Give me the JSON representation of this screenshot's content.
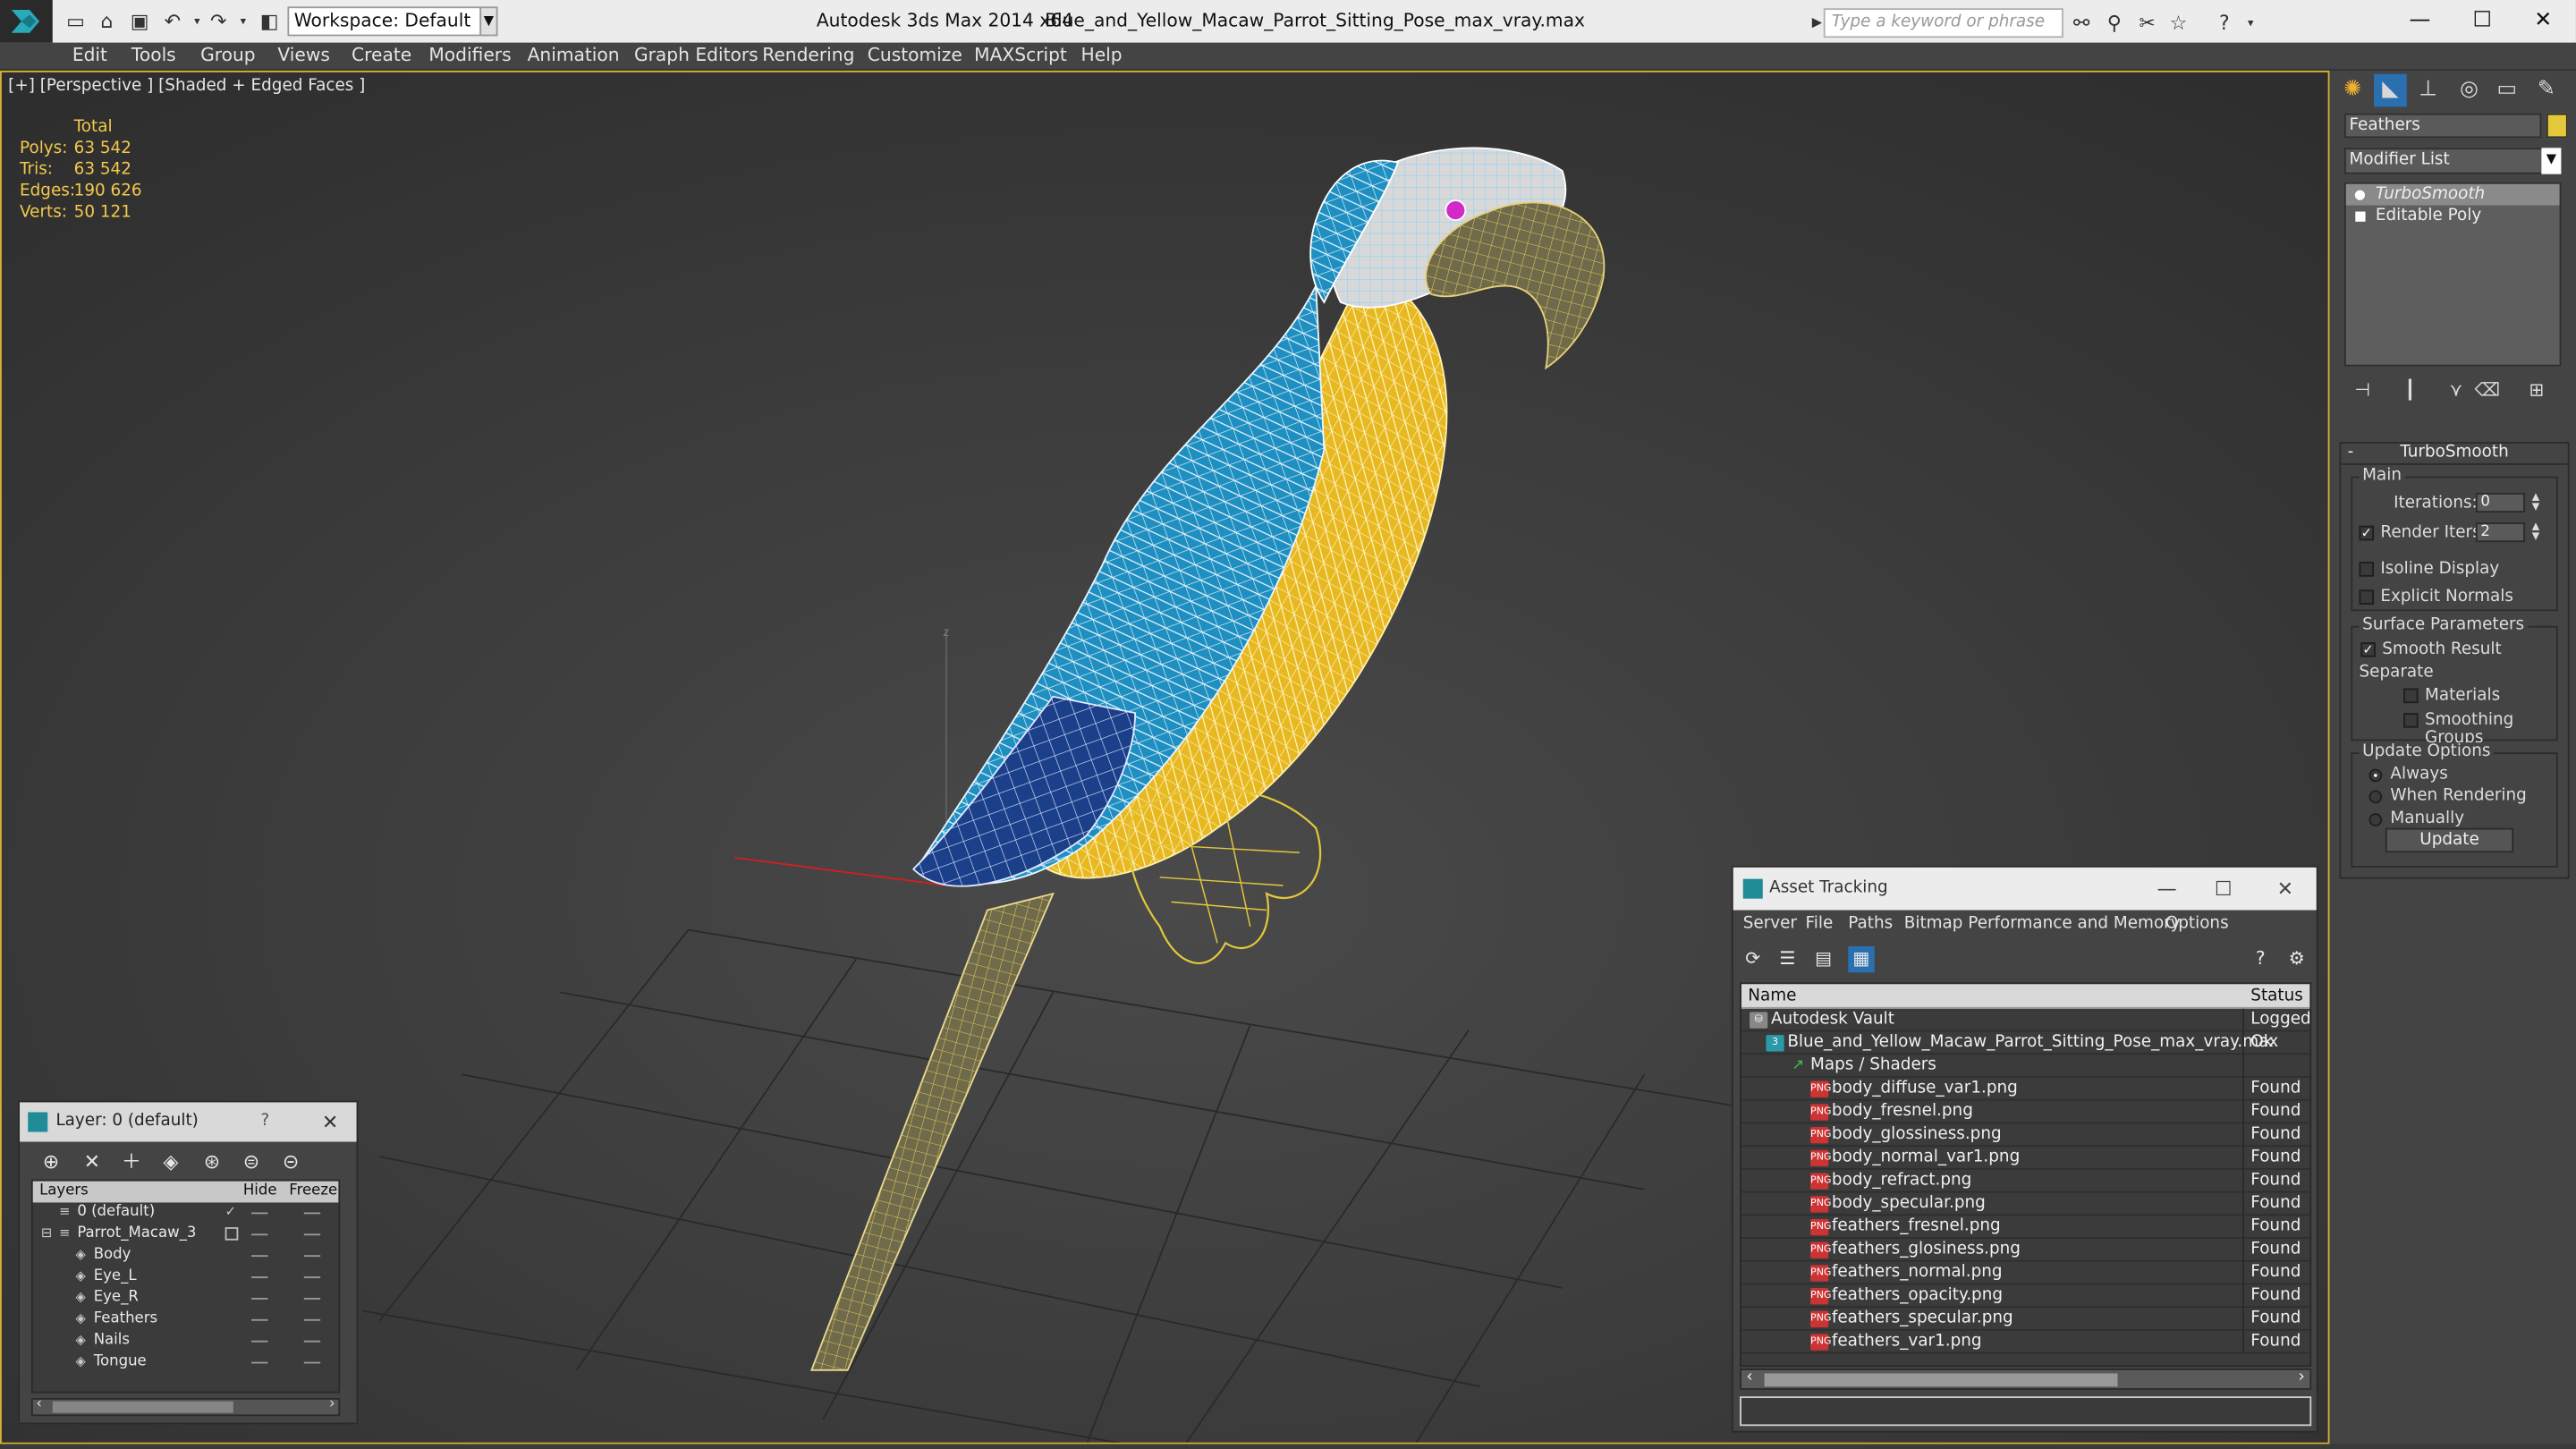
{
  "titlebar": {
    "workspace": "Workspace: Default",
    "app": "Autodesk 3ds Max  2014 x64",
    "file": "Blue_and_Yellow_Macaw_Parrot_Sitting_Pose_max_vray.max",
    "search_placeholder": "Type a keyword or phrase"
  },
  "menu": [
    "Edit",
    "Tools",
    "Group",
    "Views",
    "Create",
    "Modifiers",
    "Animation",
    "Graph Editors",
    "Rendering",
    "Customize",
    "MAXScript",
    "Help"
  ],
  "viewport": {
    "label": "[+] [Perspective ] [Shaded + Edged Faces ]",
    "stats": {
      "header": "Total",
      "rows": [
        {
          "k": "Polys:",
          "v": "63 542"
        },
        {
          "k": "Tris:",
          "v": "63 542"
        },
        {
          "k": "Edges:",
          "v": "190 626"
        },
        {
          "k": "Verts:",
          "v": "50 121"
        }
      ]
    },
    "axis_label": "z"
  },
  "command_panel": {
    "object_name": "Feathers",
    "object_color": "#e3c83b",
    "modifier_list": "Modifier List",
    "stack": [
      "TurboSmooth",
      "Editable Poly"
    ],
    "rollout_title": "TurboSmooth",
    "main_group": "Main",
    "iterations_label": "Iterations:",
    "iterations_value": "0",
    "render_iters_label": "Render Iters:",
    "render_iters_value": "2",
    "isoline_label": "Isoline Display",
    "explicit_label": "Explicit Normals",
    "surface_group": "Surface Parameters",
    "smooth_result_label": "Smooth Result",
    "separate_label": "Separate",
    "materials_label": "Materials",
    "smoothing_groups_label": "Smoothing Groups",
    "update_group": "Update Options",
    "always_label": "Always",
    "when_rendering_label": "When Rendering",
    "manually_label": "Manually",
    "update_button": "Update"
  },
  "layer_window": {
    "title": "Layer: 0 (default)",
    "help": "?",
    "columns": [
      "Layers",
      "Hide",
      "Freeze"
    ],
    "rows": [
      {
        "name": "0 (default)",
        "indent": 0
      },
      {
        "name": "Parrot_Macaw_3",
        "indent": 0
      },
      {
        "name": "Body",
        "indent": 1
      },
      {
        "name": "Eye_L",
        "indent": 1
      },
      {
        "name": "Eye_R",
        "indent": 1
      },
      {
        "name": "Feathers",
        "indent": 1
      },
      {
        "name": "Nails",
        "indent": 1
      },
      {
        "name": "Tongue",
        "indent": 1
      }
    ]
  },
  "asset_tracking": {
    "title": "Asset Tracking",
    "menu": [
      "Server",
      "File",
      "Paths",
      "Bitmap Performance and Memory",
      "Options"
    ],
    "columns": [
      "Name",
      "Status"
    ],
    "rows": [
      {
        "name": "Autodesk Vault",
        "status": "Logged",
        "indent": 0,
        "kind": "vault"
      },
      {
        "name": "Blue_and_Yellow_Macaw_Parrot_Sitting_Pose_max_vray.max",
        "status": "Ok",
        "indent": 1,
        "kind": "max"
      },
      {
        "name": "Maps / Shaders",
        "status": "",
        "indent": 2,
        "kind": "maps"
      },
      {
        "name": "body_diffuse_var1.png",
        "status": "Found",
        "indent": 3,
        "kind": "png"
      },
      {
        "name": "body_fresnel.png",
        "status": "Found",
        "indent": 3,
        "kind": "png"
      },
      {
        "name": "body_glossiness.png",
        "status": "Found",
        "indent": 3,
        "kind": "png"
      },
      {
        "name": "body_normal_var1.png",
        "status": "Found",
        "indent": 3,
        "kind": "png"
      },
      {
        "name": "body_refract.png",
        "status": "Found",
        "indent": 3,
        "kind": "png"
      },
      {
        "name": "body_specular.png",
        "status": "Found",
        "indent": 3,
        "kind": "png"
      },
      {
        "name": "feathers_fresnel.png",
        "status": "Found",
        "indent": 3,
        "kind": "png"
      },
      {
        "name": "feathers_glosiness.png",
        "status": "Found",
        "indent": 3,
        "kind": "png"
      },
      {
        "name": "feathers_normal.png",
        "status": "Found",
        "indent": 3,
        "kind": "png"
      },
      {
        "name": "feathers_opacity.png",
        "status": "Found",
        "indent": 3,
        "kind": "png"
      },
      {
        "name": "feathers_specular.png",
        "status": "Found",
        "indent": 3,
        "kind": "png"
      },
      {
        "name": "feathers_var1.png",
        "status": "Found",
        "indent": 3,
        "kind": "png"
      }
    ]
  },
  "colors": {
    "viewport_border": "#d7b233",
    "stats_text": "#f2c94c",
    "parrot_yellow": "#e8b820",
    "parrot_blue": "#1e8fc0"
  }
}
